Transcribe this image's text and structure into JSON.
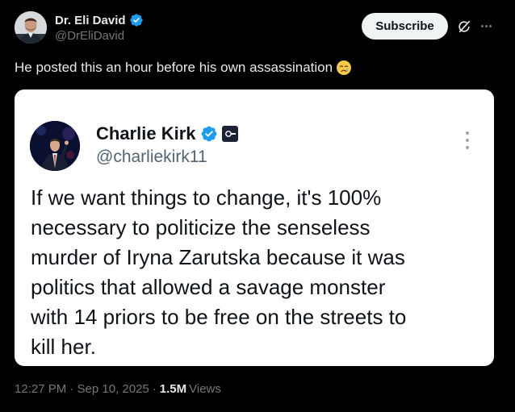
{
  "colors": {
    "background": "#000000",
    "text_primary": "#e7e9ea",
    "text_secondary": "#71767b",
    "verified_blue": "#1d9bf0",
    "card_background": "#ffffff"
  },
  "post": {
    "author": {
      "display_name": "Dr. Eli David",
      "handle": "@DrEliDavid",
      "verified": true,
      "avatar_icon": "profile-photo"
    },
    "subscribe_label": "Subscribe",
    "text": "He posted this an hour before his own assassination",
    "emoji": "crying-face-emoji",
    "timestamp": "12:27 PM · Sep 10, 2025",
    "separator": "·",
    "views_count": "1.5M",
    "views_label": "Views"
  },
  "quoted_post": {
    "author": {
      "display_name": "Charlie Kirk",
      "handle": "@charliekirk11",
      "verified": true,
      "affiliate_badge_icon": "affiliate-badge-icon"
    },
    "text_lines": [
      "If we want things to change, it's 100%",
      "necessary to politicize the senseless",
      "murder of Iryna Zarutska because it was",
      "politics that allowed a savage monster",
      "with 14 priors to be free on the streets to",
      "kill her."
    ]
  }
}
